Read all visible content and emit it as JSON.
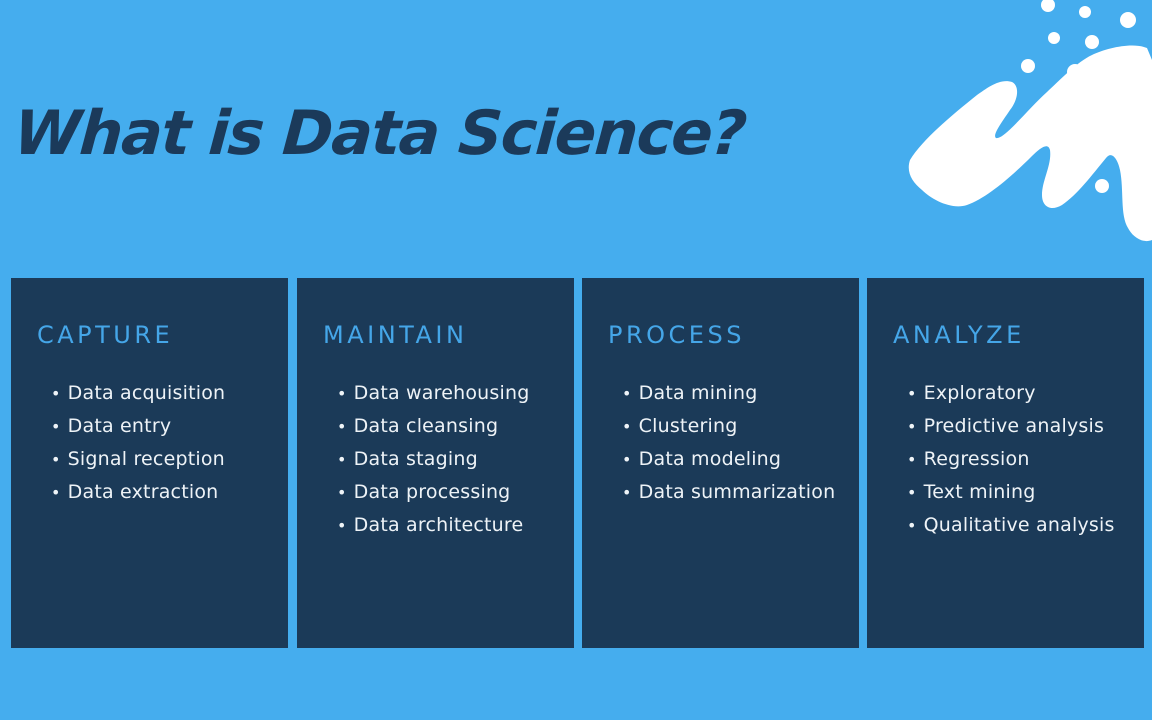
{
  "title": "What is Data Science?",
  "colors": {
    "background": "#45adee",
    "panel": "#1b3a58",
    "heading": "#45a6e8",
    "title": "#1b3a5a",
    "item_text": "#eef3f7"
  },
  "decoration": "white-brush-stroke-splash",
  "panels": [
    {
      "heading": "CAPTURE",
      "items": [
        "Data acquisition",
        "Data entry",
        "Signal reception",
        "Data extraction"
      ]
    },
    {
      "heading": "MAINTAIN",
      "items": [
        "Data warehousing",
        "Data cleansing",
        "Data staging",
        "Data processing",
        "Data architecture"
      ]
    },
    {
      "heading": "PROCESS",
      "items": [
        "Data mining",
        "Clustering",
        "Data modeling",
        "Data summarization"
      ]
    },
    {
      "heading": "ANALYZE",
      "items": [
        "Exploratory",
        "Predictive analysis",
        "Regression",
        "Text mining",
        "Qualitative analysis"
      ]
    }
  ]
}
